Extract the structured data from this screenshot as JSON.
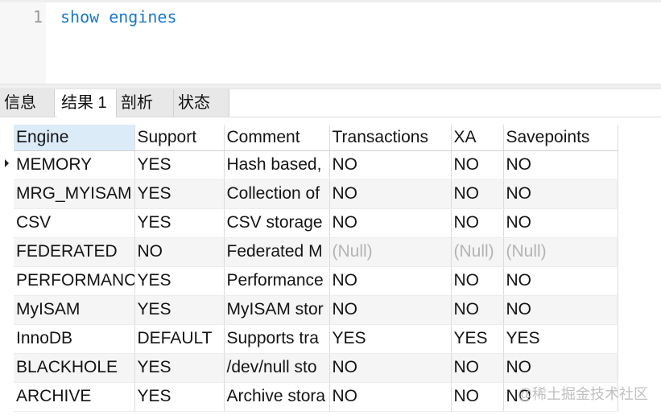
{
  "editor": {
    "line_number": "1",
    "query": "show engines"
  },
  "tabs": [
    {
      "label": "信息",
      "active": false
    },
    {
      "label": "结果 1",
      "active": true
    },
    {
      "label": "剖析",
      "active": false
    },
    {
      "label": "状态",
      "active": false
    }
  ],
  "results": {
    "columns": [
      "Engine",
      "Support",
      "Comment",
      "Transactions",
      "XA",
      "Savepoints"
    ],
    "rows": [
      [
        "MEMORY",
        "YES",
        "Hash based,",
        "NO",
        "NO",
        "NO"
      ],
      [
        "MRG_MYISAM",
        "YES",
        "Collection of",
        "NO",
        "NO",
        "NO"
      ],
      [
        "CSV",
        "YES",
        "CSV storage",
        "NO",
        "NO",
        "NO"
      ],
      [
        "FEDERATED",
        "NO",
        "Federated M",
        "(Null)",
        "(Null)",
        "(Null)"
      ],
      [
        "PERFORMANC",
        "YES",
        "Performance",
        "NO",
        "NO",
        "NO"
      ],
      [
        "MyISAM",
        "YES",
        "MyISAM stor",
        "NO",
        "NO",
        "NO"
      ],
      [
        "InnoDB",
        "DEFAULT",
        "Supports tra",
        "YES",
        "YES",
        "YES"
      ],
      [
        "BLACKHOLE",
        "YES",
        "/dev/null sto",
        "NO",
        "NO",
        "NO"
      ],
      [
        "ARCHIVE",
        "YES",
        "Archive stora",
        "NO",
        "NO",
        "NO"
      ]
    ],
    "null_text": "(Null)",
    "current_row": 0
  },
  "watermark": "@稀土掘金技术社区",
  "colors": {
    "keyword": "#1a78c8",
    "null": "#b4b4b4",
    "header_selected": "#dcebf8"
  }
}
